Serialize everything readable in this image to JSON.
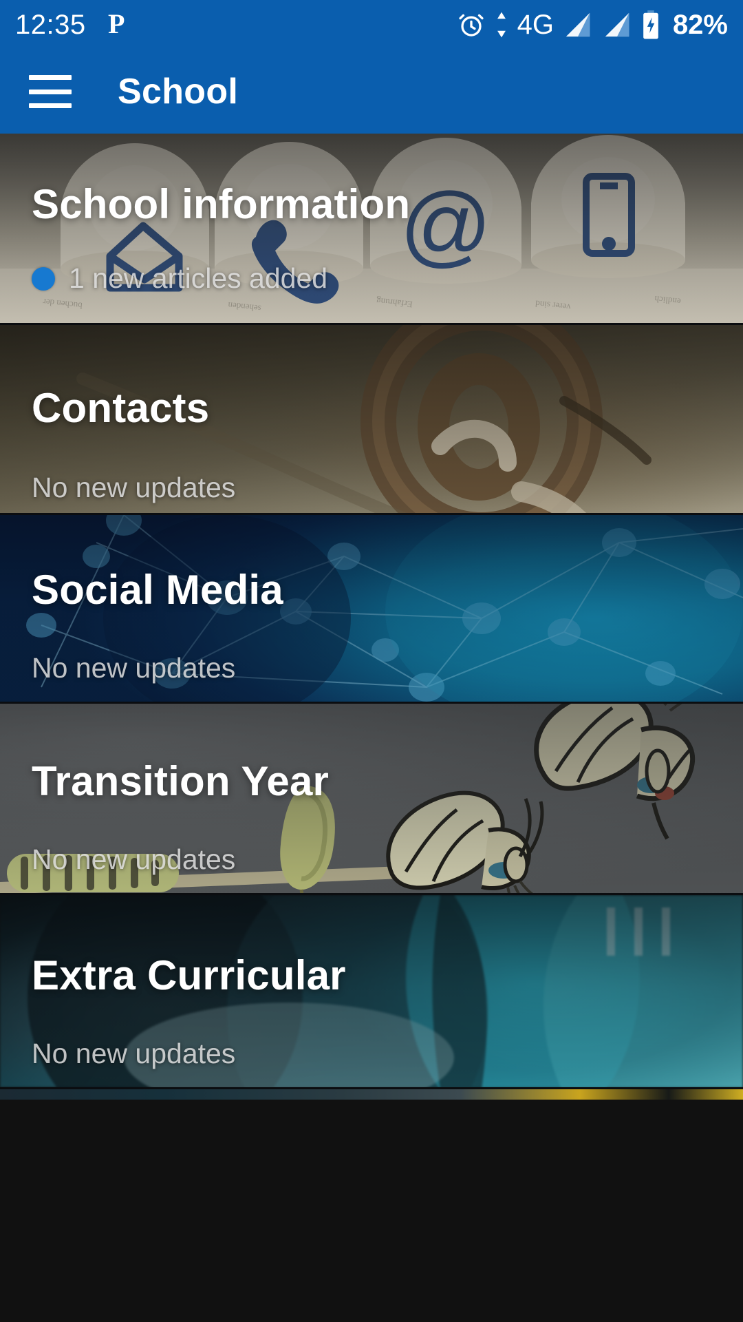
{
  "status_bar": {
    "time": "12:35",
    "icons": [
      "pinterest-icon",
      "alarm-icon",
      "data-transfer-icon",
      "signal-icon-1",
      "signal-icon-2",
      "battery-charging-icon"
    ],
    "network_type": "4G",
    "battery_percent": "82%"
  },
  "app_bar": {
    "menu_icon": "hamburger-menu-icon",
    "title": "School"
  },
  "colors": {
    "app_bar_blue": "#0A5EAE",
    "badge_blue": "#1779D0",
    "title_white": "#FFFFFF",
    "subtitle_grey": "#E8E8E8"
  },
  "cards": [
    {
      "id": "school-information",
      "title": "School information",
      "subtitle": "1 new articles added",
      "has_badge": true,
      "image_description": "wooden blocks with blue contact icons"
    },
    {
      "id": "contacts",
      "title": "Contacts",
      "subtitle": "No new updates",
      "has_badge": false,
      "image_description": "wooden at-symbol sculpture"
    },
    {
      "id": "social-media",
      "title": "Social Media",
      "subtitle": "No new updates",
      "has_badge": false,
      "image_description": "blue network node graph"
    },
    {
      "id": "transition-year",
      "title": "Transition Year",
      "subtitle": "No new updates",
      "has_badge": false,
      "image_description": "caterpillar chrysalis and butterflies"
    },
    {
      "id": "extra-curricular",
      "title": "Extra Curricular",
      "subtitle": "No new updates",
      "has_badge": false,
      "image_description": "blurred teal sports photo"
    }
  ]
}
